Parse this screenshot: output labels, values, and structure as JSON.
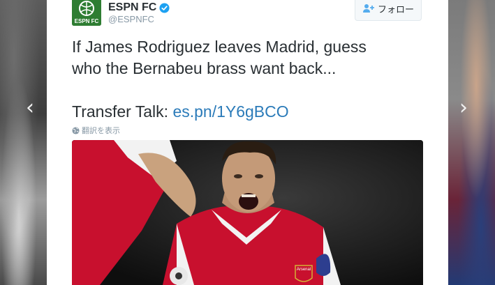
{
  "carousel": {
    "prev_icon": "chevron-left-icon",
    "next_icon": "chevron-right-icon"
  },
  "tweet": {
    "account_name": "ESPN FC",
    "handle": "@ESPNFC",
    "avatar_text": "ESPN FC",
    "verified_icon": "verified-badge-icon",
    "follow_label": "フォロー",
    "text_line_1": "If James Rodriguez leaves Madrid, guess",
    "text_line_2": "who the Bernabeu brass want back...",
    "text_prefix": "Transfer Talk: ",
    "link_text": "es.pn/1Y6gBCO",
    "translate_label": "翻訳を表示",
    "photo_crest_text": "Arsenal"
  },
  "colors": {
    "link": "#2b7bb9",
    "text": "#292f33",
    "muted": "#8899a6",
    "brand_green": "#2e7d32",
    "verified_blue": "#1da1f2"
  }
}
